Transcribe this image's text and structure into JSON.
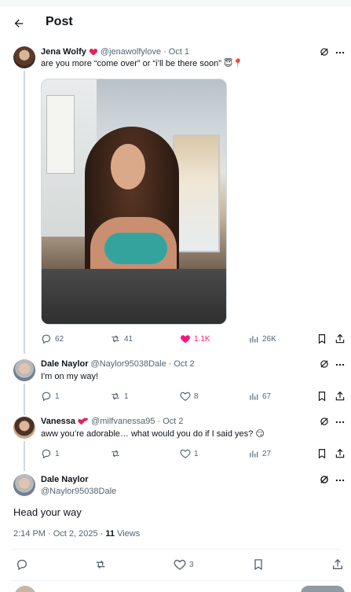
{
  "header": {
    "title": "Post"
  },
  "original_post": {
    "display_name": "Jena Wolfy",
    "handle": "@jenawolfylove",
    "date": "Oct 1",
    "text": "are you more “come over” or “i’ll be there soon” 😇📍",
    "stats": {
      "replies": "62",
      "reposts": "41",
      "likes": "1.1K",
      "views": "26K"
    }
  },
  "reply1": {
    "display_name": "Dale Naylor",
    "handle": "@Naylor95038Dale",
    "date": "Oct 2",
    "text": "I'm on my way!",
    "stats": {
      "replies": "1",
      "reposts": "1",
      "likes": "8",
      "views": "67"
    }
  },
  "reply2": {
    "display_name": "Vanessa",
    "handle": "@milfvanessa95",
    "date": "Oct 2",
    "text": "aww you’re adorable… what would you do if I said yes? 😏",
    "stats": {
      "replies": "1",
      "reposts": "",
      "likes": "1",
      "views": "27"
    }
  },
  "focused_post": {
    "display_name": "Dale Naylor",
    "handle": "@Naylor95038Dale",
    "text": "Head your way",
    "time": "2:14 PM · Oct 2, 2025 · ",
    "views_count": "11",
    "views_label": " Views",
    "stats": {
      "likes": "3"
    }
  },
  "separator": "·",
  "colors": {
    "like_active": "#f91880",
    "muted": "#536471",
    "text": "#0f1419",
    "line": "#cfd9de"
  }
}
